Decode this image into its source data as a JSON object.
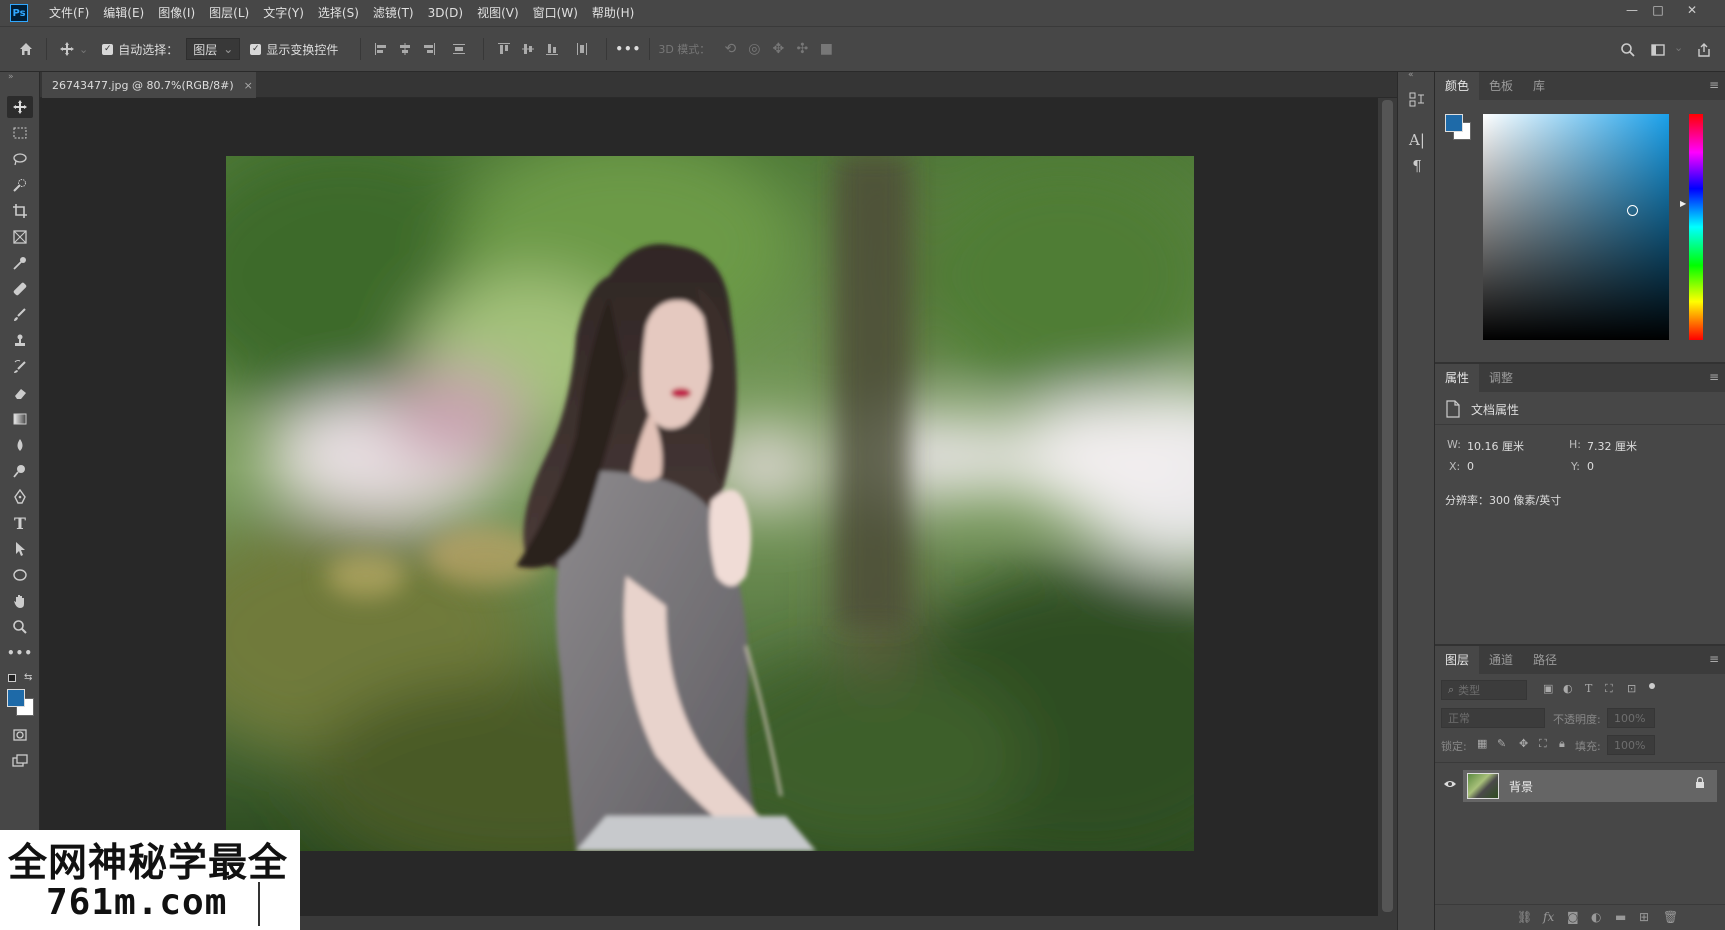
{
  "app": {
    "logo": "Ps"
  },
  "menu": [
    "文件(F)",
    "编辑(E)",
    "图像(I)",
    "图层(L)",
    "文字(Y)",
    "选择(S)",
    "滤镜(T)",
    "3D(D)",
    "视图(V)",
    "窗口(W)",
    "帮助(H)"
  ],
  "window_controls": {
    "minimize": "—",
    "maximize": "□",
    "close": "✕"
  },
  "options_bar": {
    "auto_select_label": "自动选择：",
    "auto_select_value": "图层",
    "show_transform_label": "显示变换控件",
    "more": "•••",
    "mode_3d_label": "3D 模式："
  },
  "document": {
    "tab_title": "26743477.jpg @ 80.7%(RGB/8#)",
    "close": "×"
  },
  "color_panel": {
    "tabs": [
      "颜色",
      "色板",
      "库"
    ],
    "foreground": "#1e6aa8",
    "background": "#ffffff",
    "picker_hue": "#1aa0ea"
  },
  "properties_panel": {
    "tabs": [
      "属性",
      "调整"
    ],
    "title": "文档属性",
    "w_label": "W:",
    "w_value": "10.16 厘米",
    "h_label": "H:",
    "h_value": "7.32 厘米",
    "x_label": "X:",
    "x_value": "0",
    "y_label": "Y:",
    "y_value": "0",
    "resolution": "分辨率：300 像素/英寸"
  },
  "layers_panel": {
    "tabs": [
      "图层",
      "通道",
      "路径"
    ],
    "filter_placeholder": "类型",
    "blend_mode": "正常",
    "opacity_label": "不透明度:",
    "opacity_value": "100%",
    "lock_label": "锁定:",
    "fill_label": "填充:",
    "fill_value": "100%",
    "layers": [
      {
        "name": "背景"
      }
    ]
  },
  "watermark": {
    "line1": "全网神秘学最全",
    "line2": "761m.com"
  }
}
